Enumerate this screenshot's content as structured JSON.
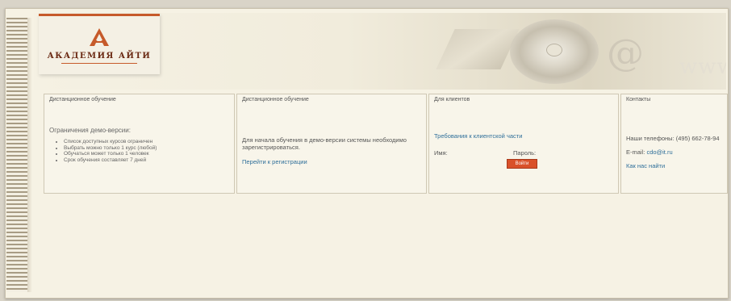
{
  "brand": {
    "name": "АКАДЕМИЯ АЙТИ",
    "accent": "#c65a2a"
  },
  "header_art": {
    "www": "www"
  },
  "panels": [
    {
      "title": "Дистанционное обучение",
      "heading": "Ограничения демо-версии:",
      "items": [
        "Список доступных курсов ограничен",
        "Выбрать можно только 1 курс (любой)",
        "Обучаться может только 1 человек",
        "Срок обучения составляет 7 дней"
      ]
    },
    {
      "title": "Дистанционное обучение",
      "text": "Для начала обучения в демо-версии системы необходимо зарегистрироваться.",
      "link": "Перейти к регистрации"
    },
    {
      "title": "Для клиентов",
      "link": "Требования к клиентской части",
      "name_label": "Имя:",
      "password_label": "Пароль:",
      "button": "Войти"
    },
    {
      "title": "Контакты",
      "phones": "Наши телефоны: (495) 662-78-94",
      "email_label": "E-mail:",
      "email": "cdo@it.ru",
      "map_link": "Как нас найти"
    }
  ]
}
